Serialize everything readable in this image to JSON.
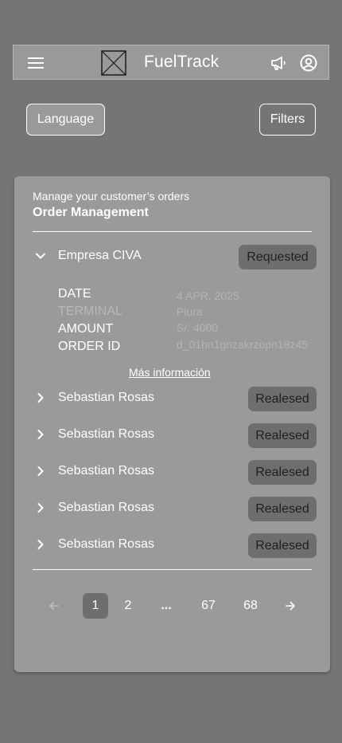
{
  "header": {
    "app_title": "FuelTrack",
    "icons": [
      "menu-icon",
      "logo-placeholder-icon",
      "megaphone-icon",
      "user-circle-icon"
    ]
  },
  "top_buttons": {
    "language": "Language",
    "filters": "Filters"
  },
  "card": {
    "subtitle": "Manage your customer’s orders",
    "title": "Order Management",
    "expanded_order": {
      "name": "Empresa CIVA",
      "status": "Requested",
      "details": [
        {
          "label": "DATE",
          "value": "4 APR, 2025"
        },
        {
          "label": "TERMINAL",
          "value": "Piura"
        },
        {
          "label": "AMOUNT",
          "value": "S/. 4000"
        },
        {
          "label": "ORDER ID",
          "value": "d_01hn1gnzakrzopn18z45"
        }
      ],
      "more_info": "Más información"
    },
    "orders": [
      {
        "name": "Sebastian Rosas",
        "status": "Realesed"
      },
      {
        "name": "Sebastian Rosas",
        "status": "Realesed"
      },
      {
        "name": "Sebastian Rosas",
        "status": "Realesed"
      },
      {
        "name": "Sebastian Rosas",
        "status": "Realesed"
      },
      {
        "name": "Sebastian Rosas",
        "status": "Realesed"
      }
    ]
  },
  "pagination": {
    "pages": [
      "1",
      "2",
      "...",
      "67",
      "68"
    ],
    "current": "1"
  },
  "colors": {
    "background": "#757575",
    "card": "#9a9a9a",
    "badge": "#6e6e6e"
  }
}
